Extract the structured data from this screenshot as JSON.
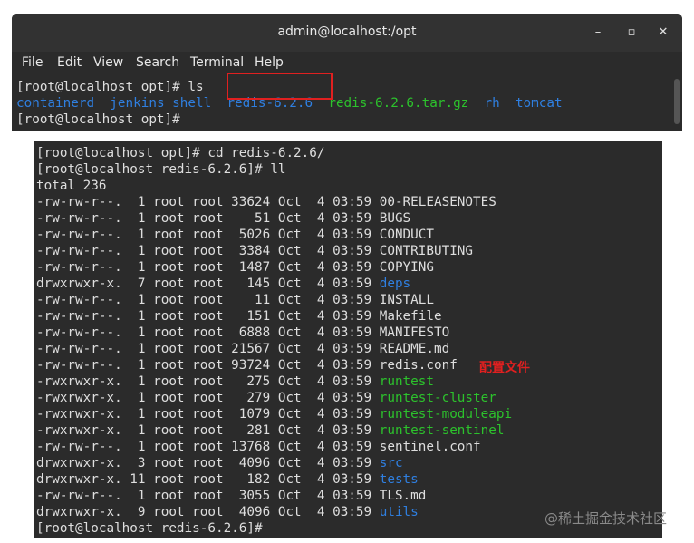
{
  "window": {
    "title": "admin@localhost:/opt",
    "controls": [
      "–",
      "▫",
      "✕"
    ]
  },
  "menu": [
    "File",
    "Edit",
    "View",
    "Search",
    "Terminal",
    "Help"
  ],
  "top_terminal": {
    "line1": "[root@localhost opt]# ls",
    "ls_entries": [
      "containerd",
      "jenkins",
      "shell",
      "redis-6.2.6",
      "redis-6.2.6.tar.gz",
      "rh",
      "tomcat"
    ],
    "line3": "[root@localhost opt]#"
  },
  "bottom_terminal": {
    "cmd1": "[root@localhost opt]# cd redis-6.2.6/",
    "cmd2": "[root@localhost redis-6.2.6]# ll",
    "total": "total 236",
    "rows": [
      {
        "perm": "-rw-rw-r--.",
        "links": "1",
        "owner": "root",
        "group": "root",
        "size": "33624",
        "month": "Oct",
        "day": "4",
        "time": "03:59",
        "name": "00-RELEASENOTES",
        "kind": "file"
      },
      {
        "perm": "-rw-rw-r--.",
        "links": "1",
        "owner": "root",
        "group": "root",
        "size": "51",
        "month": "Oct",
        "day": "4",
        "time": "03:59",
        "name": "BUGS",
        "kind": "file"
      },
      {
        "perm": "-rw-rw-r--.",
        "links": "1",
        "owner": "root",
        "group": "root",
        "size": "5026",
        "month": "Oct",
        "day": "4",
        "time": "03:59",
        "name": "CONDUCT",
        "kind": "file"
      },
      {
        "perm": "-rw-rw-r--.",
        "links": "1",
        "owner": "root",
        "group": "root",
        "size": "3384",
        "month": "Oct",
        "day": "4",
        "time": "03:59",
        "name": "CONTRIBUTING",
        "kind": "file"
      },
      {
        "perm": "-rw-rw-r--.",
        "links": "1",
        "owner": "root",
        "group": "root",
        "size": "1487",
        "month": "Oct",
        "day": "4",
        "time": "03:59",
        "name": "COPYING",
        "kind": "file"
      },
      {
        "perm": "drwxrwxr-x.",
        "links": "7",
        "owner": "root",
        "group": "root",
        "size": "145",
        "month": "Oct",
        "day": "4",
        "time": "03:59",
        "name": "deps",
        "kind": "dir"
      },
      {
        "perm": "-rw-rw-r--.",
        "links": "1",
        "owner": "root",
        "group": "root",
        "size": "11",
        "month": "Oct",
        "day": "4",
        "time": "03:59",
        "name": "INSTALL",
        "kind": "file"
      },
      {
        "perm": "-rw-rw-r--.",
        "links": "1",
        "owner": "root",
        "group": "root",
        "size": "151",
        "month": "Oct",
        "day": "4",
        "time": "03:59",
        "name": "Makefile",
        "kind": "file"
      },
      {
        "perm": "-rw-rw-r--.",
        "links": "1",
        "owner": "root",
        "group": "root",
        "size": "6888",
        "month": "Oct",
        "day": "4",
        "time": "03:59",
        "name": "MANIFESTO",
        "kind": "file"
      },
      {
        "perm": "-rw-rw-r--.",
        "links": "1",
        "owner": "root",
        "group": "root",
        "size": "21567",
        "month": "Oct",
        "day": "4",
        "time": "03:59",
        "name": "README.md",
        "kind": "file"
      },
      {
        "perm": "-rw-rw-r--.",
        "links": "1",
        "owner": "root",
        "group": "root",
        "size": "93724",
        "month": "Oct",
        "day": "4",
        "time": "03:59",
        "name": "redis.conf",
        "kind": "file"
      },
      {
        "perm": "-rwxrwxr-x.",
        "links": "1",
        "owner": "root",
        "group": "root",
        "size": "275",
        "month": "Oct",
        "day": "4",
        "time": "03:59",
        "name": "runtest",
        "kind": "exec"
      },
      {
        "perm": "-rwxrwxr-x.",
        "links": "1",
        "owner": "root",
        "group": "root",
        "size": "279",
        "month": "Oct",
        "day": "4",
        "time": "03:59",
        "name": "runtest-cluster",
        "kind": "exec"
      },
      {
        "perm": "-rwxrwxr-x.",
        "links": "1",
        "owner": "root",
        "group": "root",
        "size": "1079",
        "month": "Oct",
        "day": "4",
        "time": "03:59",
        "name": "runtest-moduleapi",
        "kind": "exec"
      },
      {
        "perm": "-rwxrwxr-x.",
        "links": "1",
        "owner": "root",
        "group": "root",
        "size": "281",
        "month": "Oct",
        "day": "4",
        "time": "03:59",
        "name": "runtest-sentinel",
        "kind": "exec"
      },
      {
        "perm": "-rw-rw-r--.",
        "links": "1",
        "owner": "root",
        "group": "root",
        "size": "13768",
        "month": "Oct",
        "day": "4",
        "time": "03:59",
        "name": "sentinel.conf",
        "kind": "file"
      },
      {
        "perm": "drwxrwxr-x.",
        "links": "3",
        "owner": "root",
        "group": "root",
        "size": "4096",
        "month": "Oct",
        "day": "4",
        "time": "03:59",
        "name": "src",
        "kind": "dir"
      },
      {
        "perm": "drwxrwxr-x.",
        "links": "11",
        "owner": "root",
        "group": "root",
        "size": "182",
        "month": "Oct",
        "day": "4",
        "time": "03:59",
        "name": "tests",
        "kind": "dir"
      },
      {
        "perm": "-rw-rw-r--.",
        "links": "1",
        "owner": "root",
        "group": "root",
        "size": "3055",
        "month": "Oct",
        "day": "4",
        "time": "03:59",
        "name": "TLS.md",
        "kind": "file"
      },
      {
        "perm": "drwxrwxr-x.",
        "links": "9",
        "owner": "root",
        "group": "root",
        "size": "4096",
        "month": "Oct",
        "day": "4",
        "time": "03:59",
        "name": "utils",
        "kind": "dir"
      }
    ],
    "prompt_end": "[root@localhost redis-6.2.6]#"
  },
  "annotation": "配置文件",
  "watermark": "@稀土掘金技术社区",
  "colors": {
    "terminal_bg": "#2b2b2b",
    "text": "#dedede",
    "directory": "#2f7fe0",
    "executable": "#2cc22c",
    "highlight_box": "#e02020"
  }
}
